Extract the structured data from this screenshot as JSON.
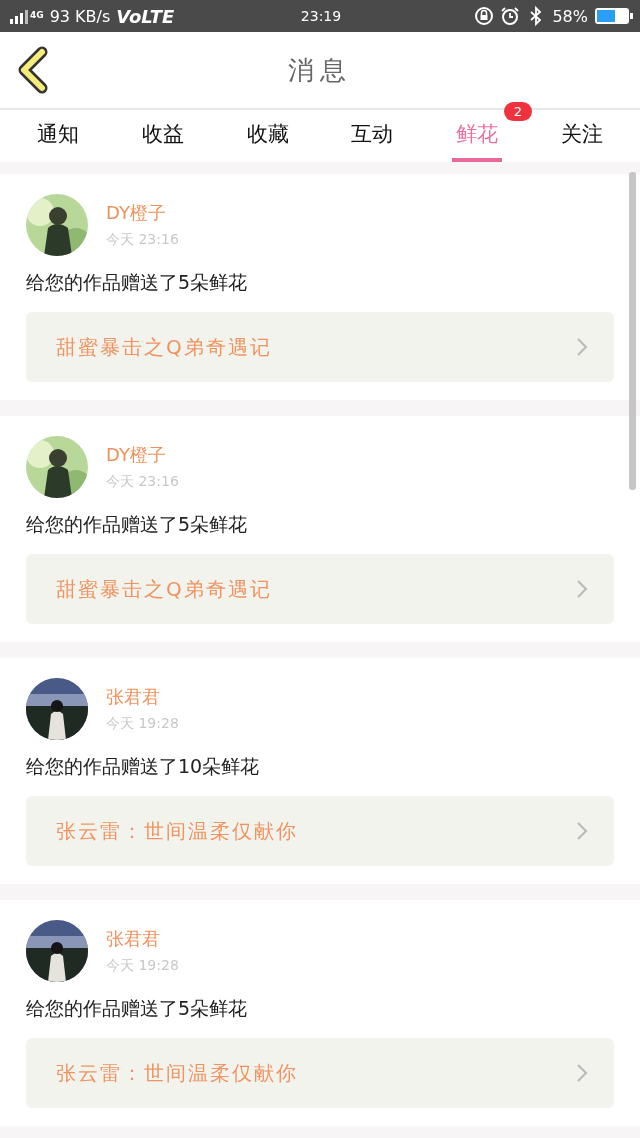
{
  "status_bar": {
    "network": "4G",
    "speed": "93 KB/s",
    "volte": "VoLTE",
    "time": "23:19",
    "battery": "58%"
  },
  "header": {
    "title": "消息"
  },
  "tabs": [
    {
      "label": "通知",
      "selected": false
    },
    {
      "label": "收益",
      "selected": false
    },
    {
      "label": "收藏",
      "selected": false
    },
    {
      "label": "互动",
      "selected": false
    },
    {
      "label": "鲜花",
      "selected": true,
      "badge": "2"
    },
    {
      "label": "关注",
      "selected": false
    }
  ],
  "messages": [
    {
      "user": "DY橙子",
      "time": "今天 23:16",
      "text": "给您的作品赠送了5朵鲜花",
      "work": "甜蜜暴击之Q弟奇遇记"
    },
    {
      "user": "DY橙子",
      "time": "今天 23:16",
      "text": "给您的作品赠送了5朵鲜花",
      "work": "甜蜜暴击之Q弟奇遇记"
    },
    {
      "user": "张君君",
      "time": "今天 19:28",
      "text": "给您的作品赠送了10朵鲜花",
      "work": "张云雷：世间温柔仅献你"
    },
    {
      "user": "张君君",
      "time": "今天 19:28",
      "text": "给您的作品赠送了5朵鲜花",
      "work": "张云雷：世间温柔仅献你"
    }
  ]
}
